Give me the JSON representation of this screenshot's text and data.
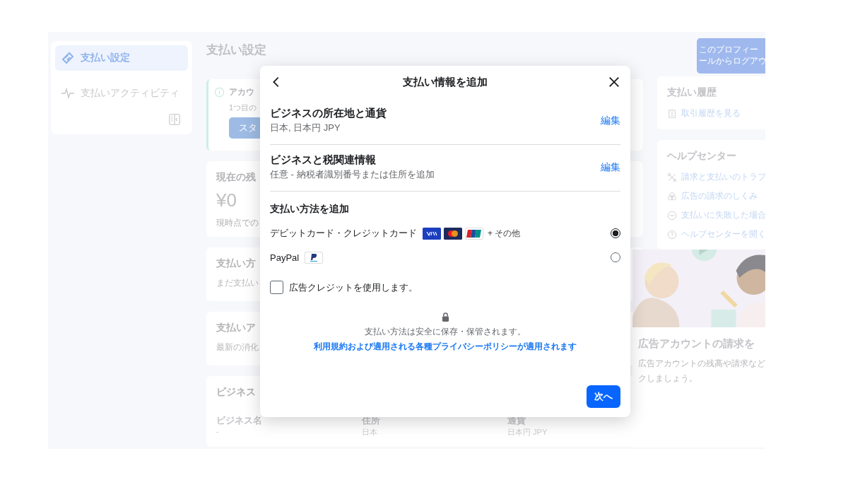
{
  "sidebar": {
    "items": [
      {
        "label": "支払い設定",
        "selected": true
      },
      {
        "label": "支払いアクティビティ",
        "selected": false
      }
    ]
  },
  "page_title": "支払い設定",
  "profile_button": {
    "lines": [
      "このプロフィー",
      "ールからログアウ"
    ]
  },
  "main_cards": [
    {
      "kind": "alert",
      "title": "アカウ",
      "text": "1つ目の",
      "button": "スタ"
    },
    {
      "kind": "balance",
      "title": "現在の残",
      "amount": "¥0",
      "note": "現時点での"
    },
    {
      "kind": "plain",
      "title": "支払い方",
      "text": "まだ支払い"
    },
    {
      "kind": "plain",
      "title": "支払いア",
      "text": "最新の消化"
    }
  ],
  "business_card": {
    "title": "ビジネス",
    "fields": [
      {
        "label": "ビジネス名",
        "value": "-"
      },
      {
        "label": "住所",
        "value": "日本"
      },
      {
        "label": "通貨",
        "value": "日本円 JPY"
      }
    ]
  },
  "history_card": {
    "title": "支払い履歴",
    "link": "取引履歴を見る"
  },
  "help_card": {
    "title": "ヘルプセンター",
    "links": [
      {
        "kind": "tools",
        "label": "請求と支払いのトラブ"
      },
      {
        "kind": "circles",
        "label": "広告の請求のしくみ"
      },
      {
        "kind": "minus",
        "label": "支払いに失敗した場合"
      },
      {
        "kind": "question",
        "label": "ヘルプセンターを開く"
      }
    ]
  },
  "promo": {
    "title": "広告アカウントの請求を",
    "lines": [
      "広告アカウントの残高や請求など",
      "クしましょう。"
    ]
  },
  "dialog": {
    "title": "支払い情報を追加",
    "sections": [
      {
        "title": "ビジネスの所在地と通貨",
        "subtitle": "日本, 日本円 JPY",
        "action": "編集"
      },
      {
        "title": "ビジネスと税関連情報",
        "subtitle": "任意 - 納税者識別番号または住所を追加",
        "action": "編集"
      }
    ],
    "methods_title": "支払い方法を追加",
    "methods": [
      {
        "kind": "cards",
        "label": "デビットカード・クレジットカード",
        "extra": "+ その他",
        "selected": true
      },
      {
        "kind": "paypal",
        "label": "PayPal",
        "selected": false
      }
    ],
    "credit": {
      "label": "広告クレジットを使用します。",
      "checked": false
    },
    "secure_note": "支払い方法は安全に保存・保管されます。",
    "policy_link": "利用規約および適用される各種プライバシーポリシーが適用されます",
    "next_button": "次へ"
  }
}
